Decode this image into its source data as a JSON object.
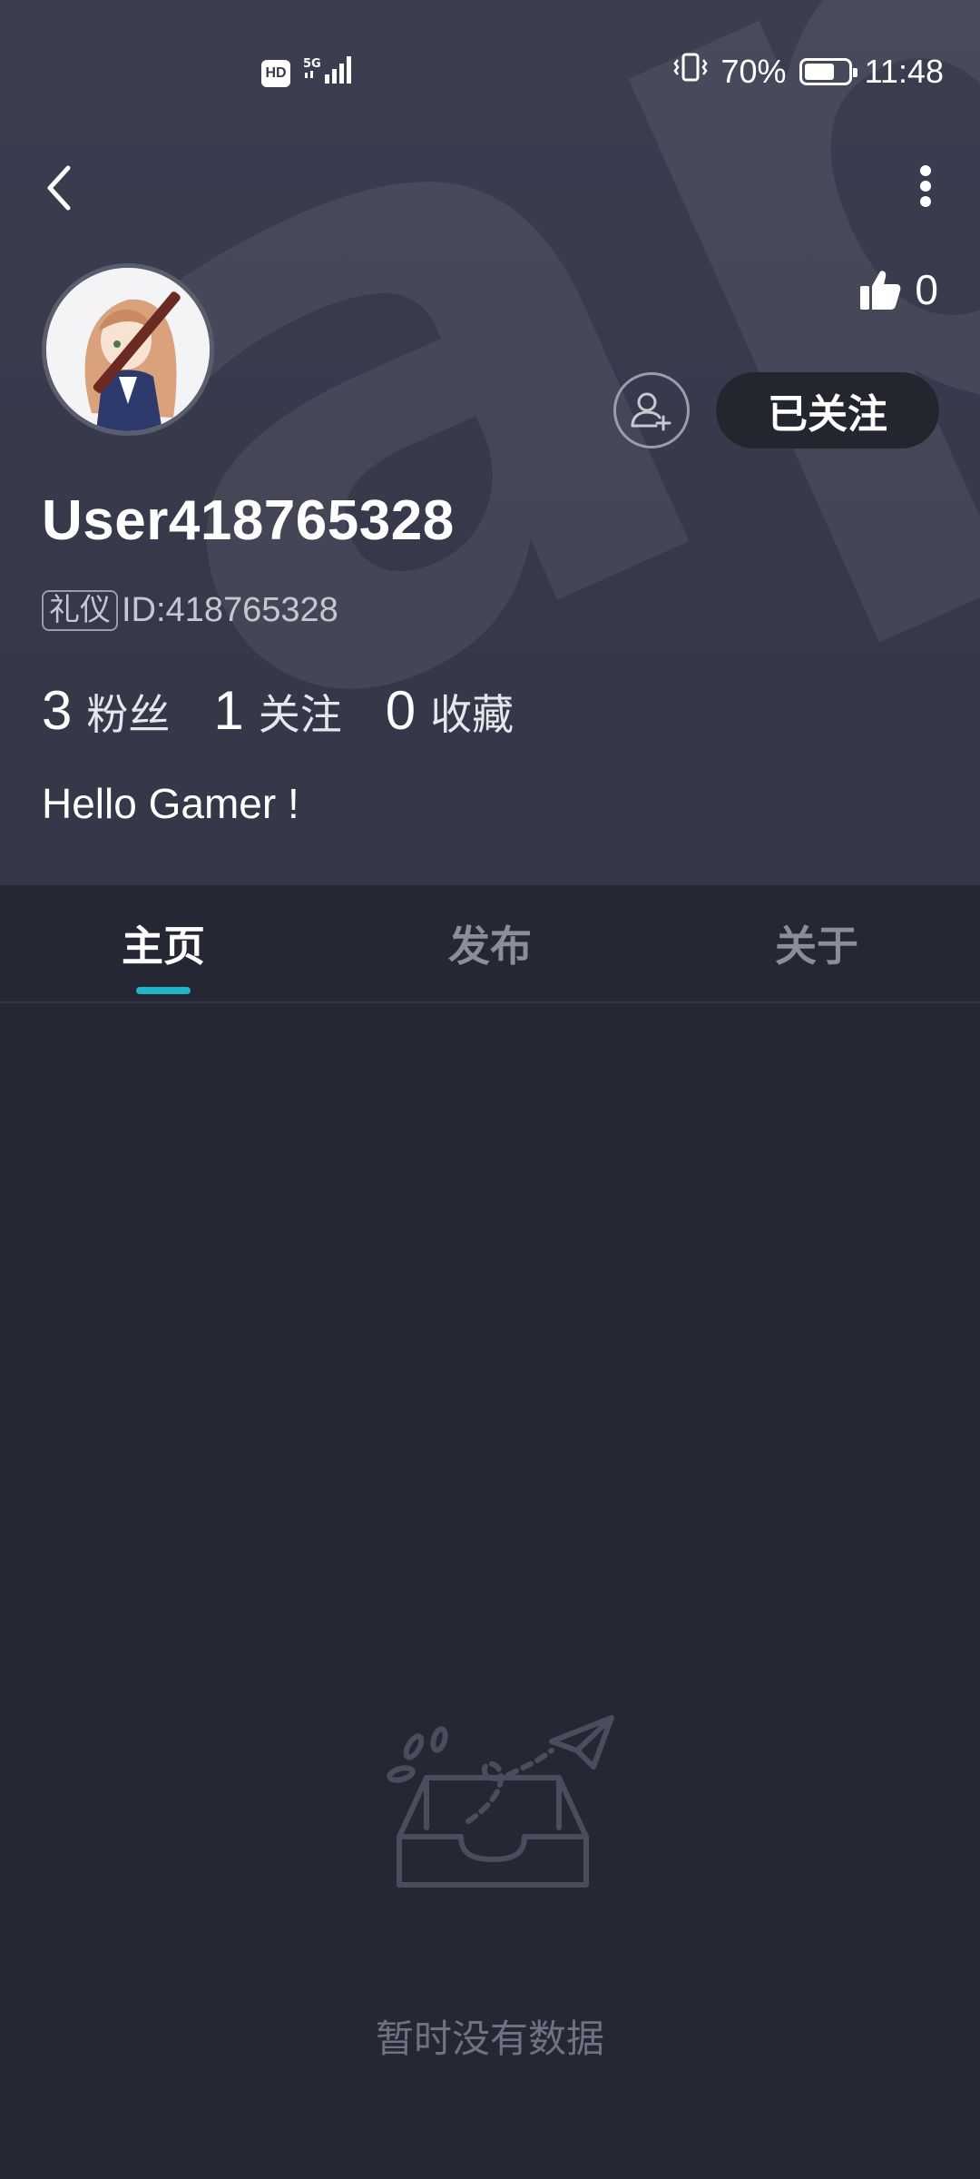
{
  "status_bar": {
    "hd_label": "HD",
    "network": "5G",
    "battery_percent_text": "70%",
    "battery_level": 0.7,
    "time": "11:48"
  },
  "header": {
    "watermark_text": "apta",
    "likes_count": "0"
  },
  "profile": {
    "username": "User418765328",
    "tag": "礼仪",
    "id_text": "ID:418765328",
    "follow_button_label": "已关注",
    "bio": "Hello Gamer !",
    "stats": [
      {
        "value": "3",
        "label": "粉丝"
      },
      {
        "value": "1",
        "label": "关注"
      },
      {
        "value": "0",
        "label": "收藏"
      }
    ]
  },
  "tabs": [
    {
      "label": "主页",
      "active": true
    },
    {
      "label": "发布",
      "active": false
    },
    {
      "label": "关于",
      "active": false
    }
  ],
  "empty_state": {
    "message": "暂时没有数据"
  },
  "colors": {
    "background": "#252734",
    "header": "#363a4b",
    "accent": "#1fb6c9"
  }
}
